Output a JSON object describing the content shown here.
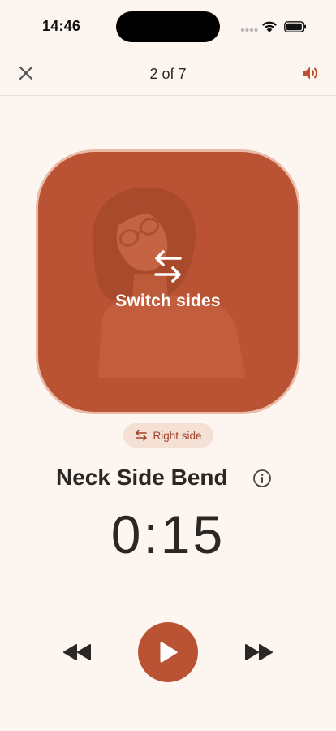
{
  "status_bar": {
    "time": "14:46"
  },
  "top_bar": {
    "progress": "2 of 7"
  },
  "card": {
    "overlay_text": "Switch sides"
  },
  "side_chip": {
    "label": "Right side"
  },
  "exercise": {
    "title": "Neck Side Bend",
    "timer": "0:15"
  },
  "icons": {
    "close": "close-icon",
    "sound": "speaker-icon",
    "switch": "swap-arrows-icon",
    "info": "info-icon",
    "rewind": "rewind-icon",
    "play": "play-icon",
    "forward": "fast-forward-icon"
  },
  "colors": {
    "accent": "#b95334",
    "background": "#fdf5f0",
    "chip_bg": "#f5e0d6",
    "text": "#2b2724"
  }
}
